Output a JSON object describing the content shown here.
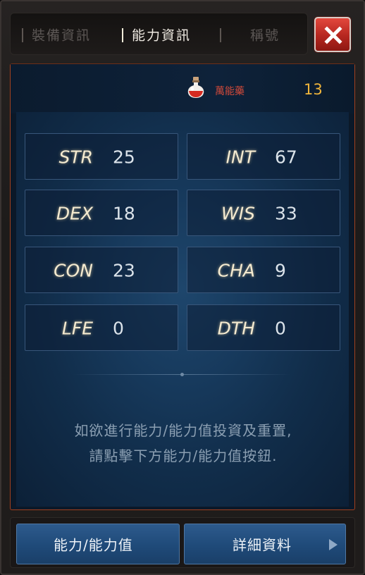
{
  "tabs": [
    {
      "label": "裝備資訊",
      "active": false
    },
    {
      "label": "能力資訊",
      "active": true
    },
    {
      "label": "稱號",
      "active": false
    }
  ],
  "icons": {
    "close": "close-icon",
    "potion": "potion-icon",
    "arrow": "arrow-right-icon"
  },
  "currency": {
    "label": "萬能藥",
    "value": "13"
  },
  "stats": [
    {
      "name": "STR",
      "value": "25"
    },
    {
      "name": "INT",
      "value": "67"
    },
    {
      "name": "DEX",
      "value": "18"
    },
    {
      "name": "WIS",
      "value": "33"
    },
    {
      "name": "CON",
      "value": "23"
    },
    {
      "name": "CHA",
      "value": "9"
    },
    {
      "name": "LFE",
      "value": "0"
    },
    {
      "name": "DTH",
      "value": "0"
    }
  ],
  "info": {
    "line1": "如欲進行能力/能力值投資及重置,",
    "line2": "請點擊下方能力/能力值按鈕."
  },
  "footer": {
    "ability_button": "能力/能力值",
    "details_button": "詳細資料"
  },
  "colors": {
    "accent_gold": "#f0b53b",
    "close_red": "#c8342a",
    "button_blue": "#24507f"
  }
}
